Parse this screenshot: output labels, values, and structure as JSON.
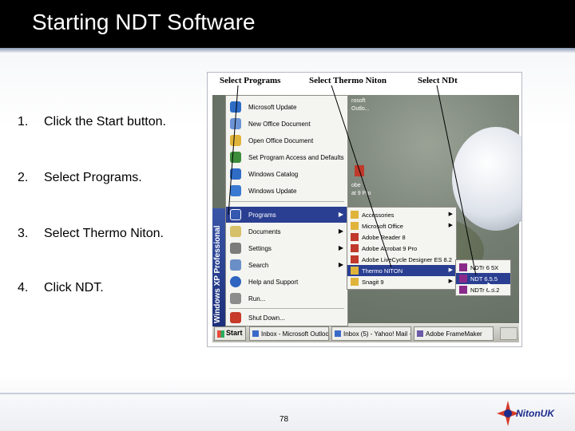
{
  "slide": {
    "title": "Starting NDT Software",
    "page_number": "78",
    "logo_text": "NitonUK"
  },
  "steps": [
    {
      "number": "1.",
      "text": "Click the Start button."
    },
    {
      "number": "2.",
      "text": "Select Programs."
    },
    {
      "number": "3.",
      "text": "Select Thermo Niton."
    },
    {
      "number": "4.",
      "text": "Click NDT."
    }
  ],
  "screenshot": {
    "annotations": [
      "Select Programs",
      "Select Thermo Niton",
      "Select NDt"
    ],
    "side_band": "Windows XP Professional",
    "start_menu": [
      {
        "label": "Microsoft Update",
        "icon": "globe-icon",
        "icon_color": "#2f6cc6"
      },
      {
        "label": "New Office Document",
        "icon": "document-icon",
        "icon_color": "#6b93d6"
      },
      {
        "label": "Open Office Document",
        "icon": "folder-icon",
        "icon_color": "#e0b43a"
      },
      {
        "label": "Set Program Access and Defaults",
        "icon": "settings-icon",
        "icon_color": "#3d8c3a"
      },
      {
        "label": "Windows Catalog",
        "icon": "globe-icon",
        "icon_color": "#2f6cc6"
      },
      {
        "label": "Windows Update",
        "icon": "windows-icon",
        "icon_color": "#3a7ad2"
      },
      {
        "label": "Programs",
        "icon": "programs-icon",
        "icon_color": "#3558b0",
        "highlighted": true,
        "has_submenu": true
      },
      {
        "label": "Documents",
        "icon": "documents-icon",
        "icon_color": "#d6c069",
        "has_submenu": true
      },
      {
        "label": "Settings",
        "icon": "settings-icon",
        "icon_color": "#7b7b7b",
        "has_submenu": true
      },
      {
        "label": "Search",
        "icon": "search-icon",
        "icon_color": "#6a8fc7",
        "has_submenu": true
      },
      {
        "label": "Help and Support",
        "icon": "help-icon",
        "icon_color": "#2f64c0"
      },
      {
        "label": "Run...",
        "icon": "run-icon",
        "icon_color": "#8c8c8c"
      },
      {
        "label": "Shut Down...",
        "icon": "power-icon",
        "icon_color": "#c63b2a"
      }
    ],
    "programs_menu": [
      {
        "label": "Accessories",
        "has_submenu": true
      },
      {
        "label": "Microsoft Office",
        "has_submenu": true
      },
      {
        "label": "Adobe Reader 8"
      },
      {
        "label": "Adobe Acrobat 9 Pro"
      },
      {
        "label": "Adobe LiveCycle Designer ES 8.2"
      },
      {
        "label": "Thermo NITON",
        "highlighted": true,
        "has_submenu": true
      },
      {
        "label": "Snagit 9",
        "has_submenu": true
      }
    ],
    "niton_menu": [
      {
        "label": "NDTr 6 5X"
      },
      {
        "label": "NDT 6.5.5",
        "highlighted": true
      },
      {
        "label": "NDTr 6.5.2"
      }
    ],
    "taskbar": {
      "start_label": "Start",
      "tasks": [
        "Inbox - Microsoft Outlook",
        "Inbox (5) - Yahoo! Mail - ...",
        "Adobe FrameMaker"
      ]
    },
    "desktop_labels": [
      "rosoft",
      "Outlo...",
      "obe",
      "at 9 Pro"
    ]
  },
  "colors": {
    "title_bar": "#000000",
    "menu_highlight": "#2a3f92",
    "arrow": "#000000"
  }
}
